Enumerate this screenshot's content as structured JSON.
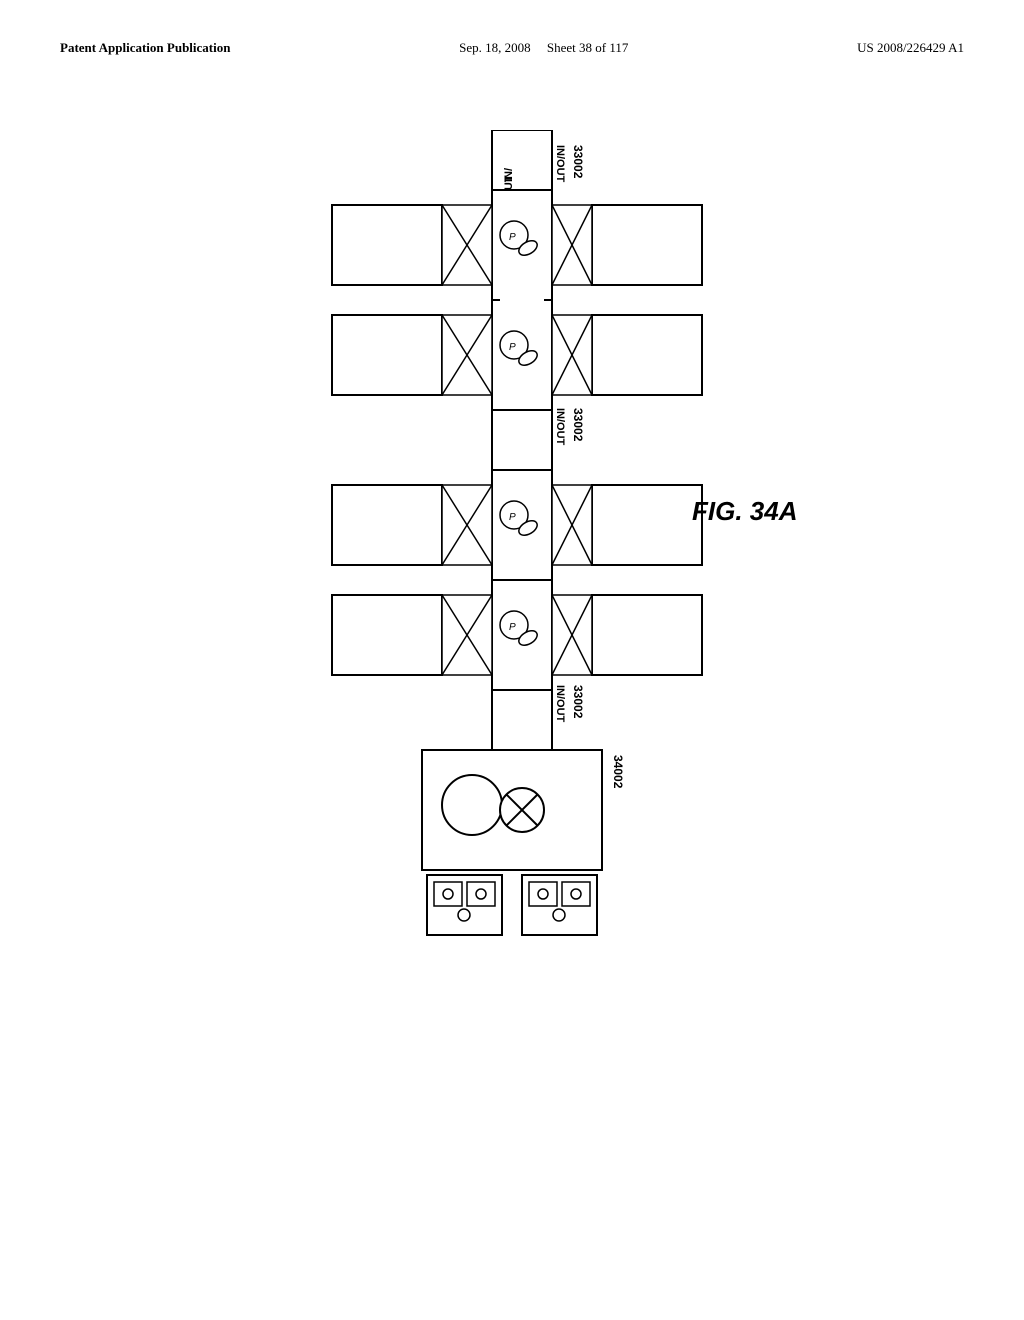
{
  "header": {
    "left": "Patent Application Publication",
    "center_date": "Sep. 18, 2008",
    "center_sheet": "Sheet 38 of 117",
    "right": "US 2008/226429 A1"
  },
  "figure": {
    "label": "FIG. 34A",
    "labels": {
      "label_33002": "33002",
      "label_34002": "34002",
      "label_in_out": "IN/OUT"
    }
  }
}
